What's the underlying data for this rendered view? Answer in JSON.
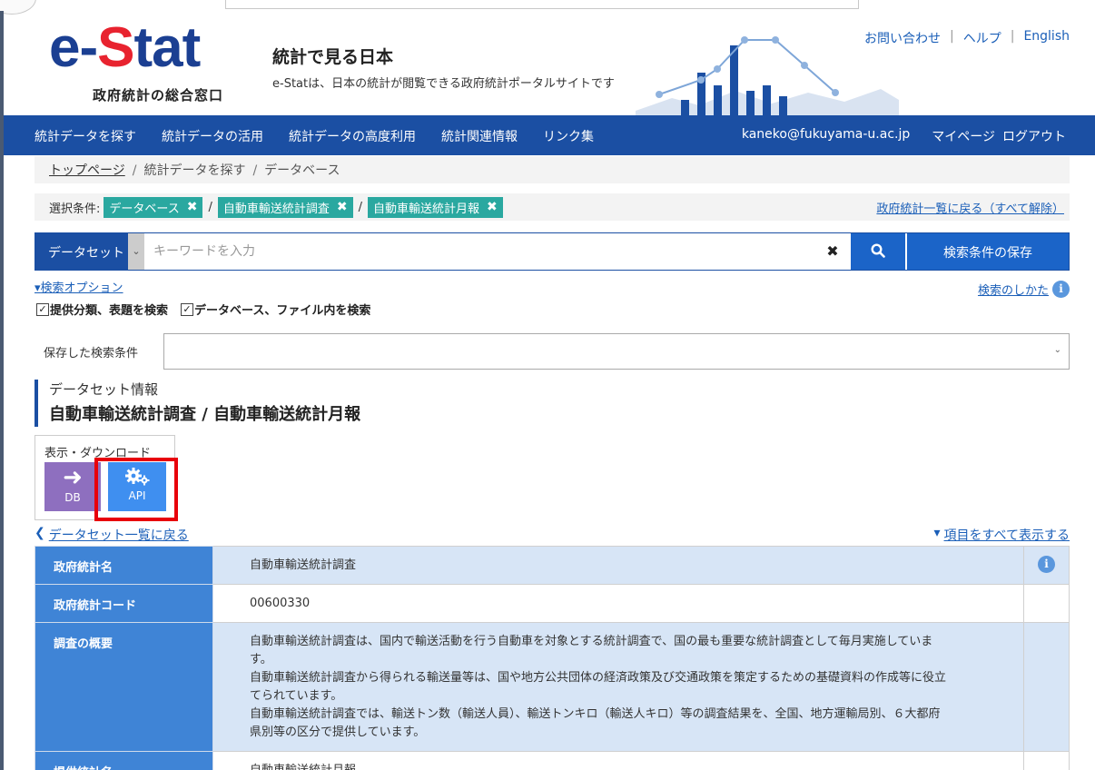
{
  "header": {
    "logo_text_a": "e-",
    "logo_text_s": "S",
    "logo_text_b": "tat",
    "logo_sub": "政府統計の総合窓口",
    "tagline_title": "統計で見る日本",
    "tagline_sub": "e-Statは、日本の統計が閲覧できる政府統計ポータルサイトです",
    "util_links": [
      "お問い合わせ",
      "ヘルプ",
      "English"
    ]
  },
  "nav": {
    "items": [
      "統計データを探す",
      "統計データの活用",
      "統計データの高度利用",
      "統計関連情報",
      "リンク集"
    ],
    "user_email": "kaneko@fukuyama-u.ac.jp",
    "mypage": "マイページ",
    "logout": "ログアウト"
  },
  "breadcrumb": [
    "トップページ",
    "統計データを探す",
    "データベース"
  ],
  "conditions": {
    "label": "選択条件:",
    "tags": [
      "データベース",
      "自動車輸送統計調査",
      "自動車輸送統計月報"
    ],
    "reset_link": "政府統計一覧に戻る（すべて解除）"
  },
  "search": {
    "type_label": "データセット",
    "placeholder": "キーワードを入力",
    "save_label": "検索条件の保存",
    "option_link": "検索オプション",
    "howto_link": "検索のしかた",
    "check_1": "提供分類、表題を検索",
    "check_2": "データベース、ファイル内を検索",
    "saved_label": "保存した検索条件"
  },
  "dataset": {
    "label": "データセット情報",
    "title": "自動車輸送統計調査 / 自動車輸送統計月報",
    "download_label": "表示・ダウンロード",
    "db_button": "DB",
    "api_button": "API",
    "back_link": "データセット一覧に戻る",
    "show_all_link": "項目をすべて表示する"
  },
  "info_table": {
    "rows": [
      {
        "label": "政府統計名",
        "value": "自動車輸送統計調査"
      },
      {
        "label": "政府統計コード",
        "value": "00600330"
      },
      {
        "label": "調査の概要",
        "lines": [
          "自動車輸送統計調査は、国内で輸送活動を行う自動車を対象とする統計調査で、国の最も重要な統計調査として毎月実施していま",
          "す。",
          "自動車輸送統計調査から得られる輸送量等は、国や地方公共団体の経済政策及び交通政策を策定するための基礎資料の作成等に役立",
          "てられています。",
          "自動車輸送統計調査では、輸送トン数（輸送人員）、輸送トンキロ（輸送人キロ）等の調査結果を、全国、地方運輸局別、６大都府",
          "県別等の区分で提供しています。"
        ]
      },
      {
        "label": "提供統計名",
        "value": "自動車輸送統計月報"
      }
    ]
  },
  "colors": {
    "navy": "#1b4fa3",
    "tag_teal": "#2aa8a0",
    "db_purple": "#8e6fbf",
    "api_blue": "#3f8ff0",
    "highlight_red": "#e8000b"
  }
}
